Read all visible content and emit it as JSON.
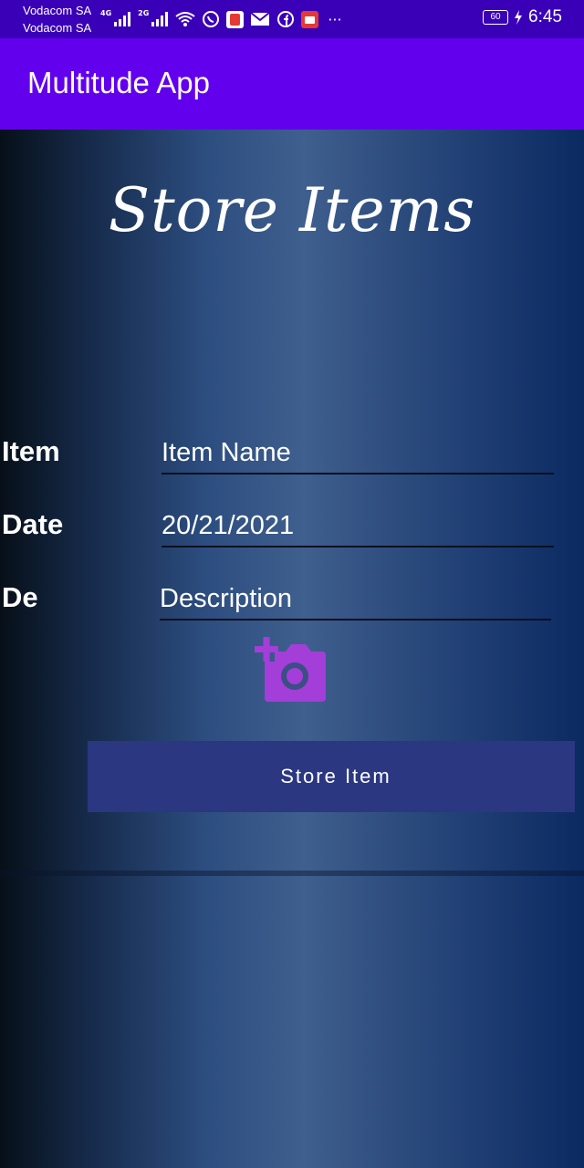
{
  "status_bar": {
    "carrier_1": "Vodacom SA",
    "carrier_2": "Vodacom SA",
    "net_1": "4G",
    "net_2": "2G",
    "battery": "60",
    "time": "6:45",
    "more": "···"
  },
  "app_bar": {
    "title": "Multitude App"
  },
  "page": {
    "title": "Store Items"
  },
  "form": {
    "item_label": "Item",
    "item_value": "Item Name",
    "date_label": "Date",
    "date_value": "20/21/2021",
    "desc_label": "De",
    "desc_value": "Description"
  },
  "actions": {
    "store_button": "Store Item"
  },
  "colors": {
    "status_bar": "#3a00b8",
    "app_bar": "#6200ee",
    "camera_icon": "#a43ed8",
    "button_bg": "#2b3781"
  }
}
